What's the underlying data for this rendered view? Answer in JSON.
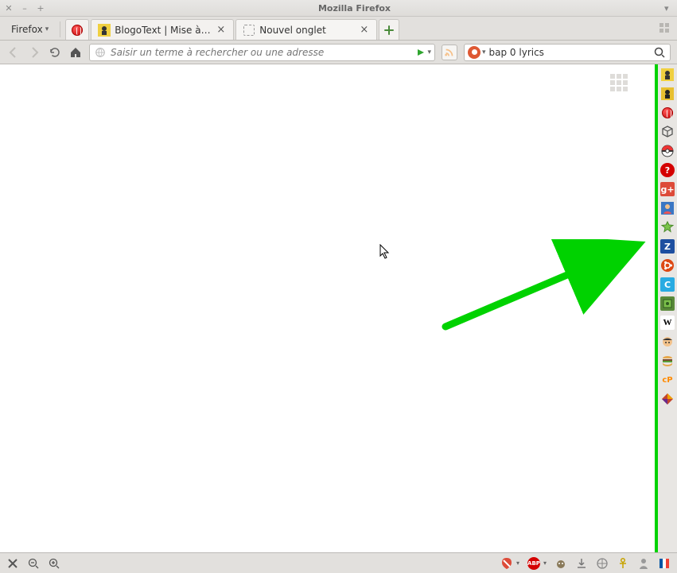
{
  "window": {
    "title": "Mozilla Firefox"
  },
  "menu_label": "Firefox",
  "tabs": [
    {
      "label": "",
      "icon": "opera"
    },
    {
      "label": "BlogoText | Mise à j...",
      "icon": "blogotext"
    },
    {
      "label": "Nouvel onglet",
      "icon": "dashed",
      "active": true
    }
  ],
  "urlbar": {
    "placeholder": "Saisir un terme à rechercher ou une adresse",
    "value": ""
  },
  "searchbar": {
    "engine": "DuckDuckGo",
    "value": "bap 0 lyrics"
  },
  "sidebar_bookmarks": [
    {
      "name": "blogotext",
      "title": "BlogoText"
    },
    {
      "name": "blogotext-alt",
      "title": "BlogoText"
    },
    {
      "name": "opera",
      "title": "Opera"
    },
    {
      "name": "cube",
      "title": "3D"
    },
    {
      "name": "pokeball",
      "title": "Poké"
    },
    {
      "name": "help",
      "title": "Help"
    },
    {
      "name": "gplus",
      "title": "Google+"
    },
    {
      "name": "avatar",
      "title": "User"
    },
    {
      "name": "star",
      "title": "Fav"
    },
    {
      "name": "zbox",
      "title": "Z"
    },
    {
      "name": "ubuntu",
      "title": "Ubuntu"
    },
    {
      "name": "cbox",
      "title": "C"
    },
    {
      "name": "chip",
      "title": "Chip"
    },
    {
      "name": "wikipedia",
      "title": "Wikipedia",
      "label": "W"
    },
    {
      "name": "face",
      "title": "Face"
    },
    {
      "name": "burger",
      "title": "Menu"
    },
    {
      "name": "cp",
      "title": "cP",
      "label": "cP"
    },
    {
      "name": "tile",
      "title": "Tile"
    }
  ],
  "status_icons": {
    "abp": "ABP"
  }
}
